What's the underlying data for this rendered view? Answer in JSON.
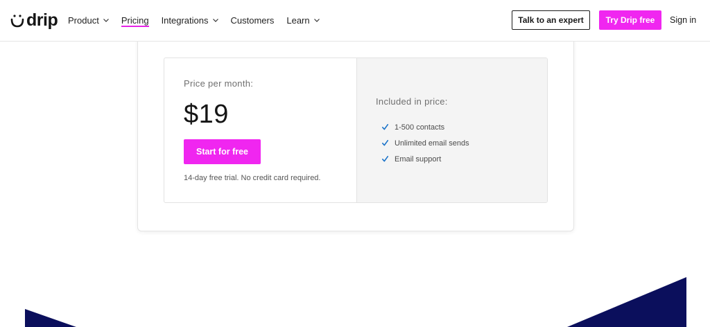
{
  "header": {
    "logo_text": "drip",
    "nav": [
      {
        "label": "Product",
        "has_dropdown": true,
        "active": false
      },
      {
        "label": "Pricing",
        "has_dropdown": false,
        "active": true
      },
      {
        "label": "Integrations",
        "has_dropdown": true,
        "active": false
      },
      {
        "label": "Customers",
        "has_dropdown": false,
        "active": false
      },
      {
        "label": "Learn",
        "has_dropdown": true,
        "active": false
      }
    ],
    "talk_button": "Talk to an expert",
    "try_button": "Try Drip free",
    "signin": "Sign in"
  },
  "plan": {
    "price_label": "Price per month:",
    "price": "$19",
    "cta": "Start for free",
    "trial_note": "14-day free trial. No credit card required.",
    "included_label": "Included in price:",
    "features": [
      "1-500 contacts",
      "Unlimited email sends",
      "Email support"
    ]
  },
  "colors": {
    "accent_pink": "#f026f0",
    "navy": "#0b0f5c",
    "check_blue": "#1a73c9"
  }
}
